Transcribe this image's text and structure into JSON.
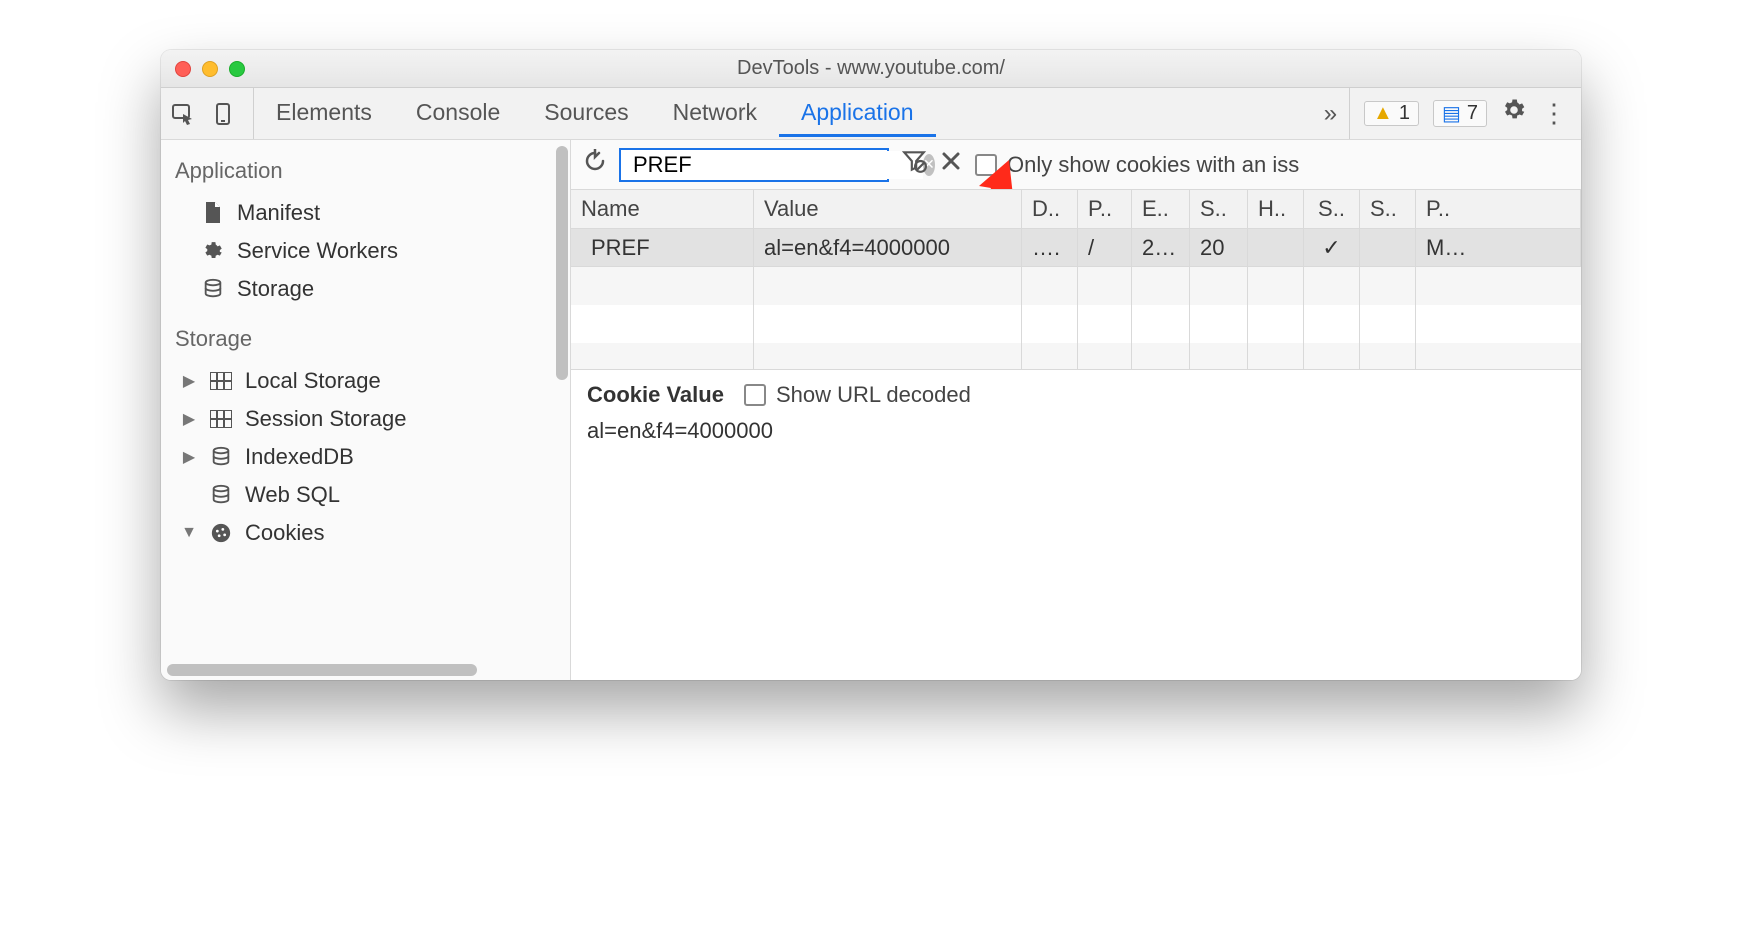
{
  "window": {
    "title": "DevTools - www.youtube.com/"
  },
  "toolbar": {
    "tabs": [
      "Elements",
      "Console",
      "Sources",
      "Network",
      "Application"
    ],
    "active_tab": "Application",
    "more_glyph": "»",
    "warnings_count": "1",
    "messages_count": "7"
  },
  "sidebar": {
    "group_application": "Application",
    "application_items": [
      {
        "icon": "manifest",
        "label": "Manifest"
      },
      {
        "icon": "gear",
        "label": "Service Workers"
      },
      {
        "icon": "storage",
        "label": "Storage"
      }
    ],
    "group_storage": "Storage",
    "storage_items": [
      {
        "disclosure": "▶",
        "icon": "grid",
        "label": "Local Storage"
      },
      {
        "disclosure": "▶",
        "icon": "grid",
        "label": "Session Storage"
      },
      {
        "disclosure": "▶",
        "icon": "storage",
        "label": "IndexedDB"
      },
      {
        "disclosure": "",
        "icon": "storage",
        "label": "Web SQL"
      },
      {
        "disclosure": "▼",
        "icon": "cookie",
        "label": "Cookies"
      }
    ]
  },
  "cookie_toolbar": {
    "filter_value": "PREF",
    "only_show_label": "Only show cookies with an iss"
  },
  "table": {
    "headers": {
      "name": "Name",
      "value": "Value",
      "d": "D..",
      "p": "P..",
      "e": "E..",
      "s": "S..",
      "h": "H..",
      "s2": "S..",
      "s3": "S..",
      "pr": "P.."
    },
    "row": {
      "name": "PREF",
      "value": "al=en&f4=4000000",
      "d": "….",
      "p": "/",
      "e": "2…",
      "s": "20",
      "h": "",
      "s2": "✓",
      "s3": "",
      "pr": "M…"
    }
  },
  "detail": {
    "cv_label": "Cookie Value",
    "url_decode_label": "Show URL decoded",
    "value": "al=en&f4=4000000"
  }
}
